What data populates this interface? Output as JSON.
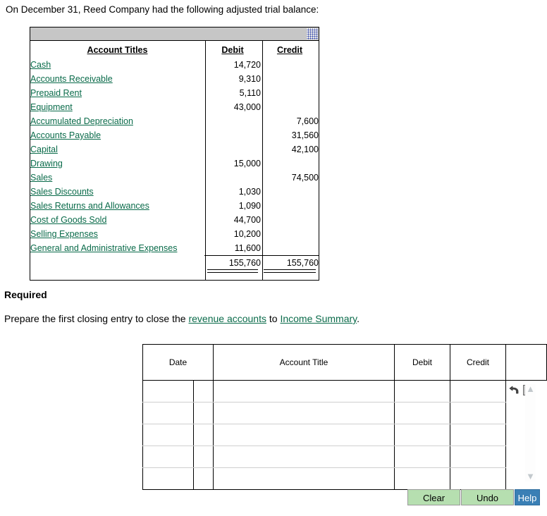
{
  "intro": "On December 31, Reed Company had the following adjusted trial balance:",
  "trial_balance": {
    "columns": [
      "Account Titles",
      "Debit",
      "Credit"
    ],
    "rows": [
      {
        "account": "Cash",
        "debit": "14,720",
        "credit": ""
      },
      {
        "account": "Accounts Receivable",
        "debit": "9,310",
        "credit": ""
      },
      {
        "account": "Prepaid Rent",
        "debit": "5,110",
        "credit": ""
      },
      {
        "account": "Equipment",
        "debit": "43,000",
        "credit": ""
      },
      {
        "account": "Accumulated Depreciation",
        "debit": "",
        "credit": "7,600"
      },
      {
        "account": "Accounts Payable",
        "debit": "",
        "credit": "31,560"
      },
      {
        "account": "Capital",
        "debit": "",
        "credit": "42,100"
      },
      {
        "account": "Drawing",
        "debit": "15,000",
        "credit": ""
      },
      {
        "account": "Sales",
        "debit": "",
        "credit": "74,500"
      },
      {
        "account": "Sales Discounts",
        "debit": "1,030",
        "credit": ""
      },
      {
        "account": "Sales Returns and Allowances",
        "debit": "1,090",
        "credit": ""
      },
      {
        "account": "Cost of Goods Sold",
        "debit": "44,700",
        "credit": ""
      },
      {
        "account": "Selling Expenses",
        "debit": "10,200",
        "credit": ""
      },
      {
        "account": "General and Administrative Expenses",
        "debit": "11,600",
        "credit": ""
      }
    ],
    "totals": {
      "debit": "155,760",
      "credit": "155,760"
    }
  },
  "required": {
    "heading": "Required",
    "text_before": "Prepare the first closing entry to close the ",
    "link1": "revenue accounts",
    "text_middle": " to ",
    "link2": "Income Summary",
    "text_after": "."
  },
  "journal": {
    "columns": [
      "Date",
      "Account Title",
      "Debit",
      "Credit"
    ],
    "rows": [
      {
        "date": "",
        "date2": "",
        "title": "",
        "debit": "",
        "credit": ""
      },
      {
        "date": "",
        "date2": "",
        "title": "",
        "debit": "",
        "credit": ""
      },
      {
        "date": "",
        "date2": "",
        "title": "",
        "debit": "",
        "credit": ""
      },
      {
        "date": "",
        "date2": "",
        "title": "",
        "debit": "",
        "credit": ""
      },
      {
        "date": "",
        "date2": "",
        "title": "",
        "debit": "",
        "credit": ""
      }
    ],
    "row_actions": {
      "delete_label": "×"
    }
  },
  "buttons": {
    "clear": "Clear",
    "undo": "Undo",
    "help": "Help"
  },
  "colors": {
    "link_green": "#0a6b4a",
    "button_green": "#b6dfb0",
    "help_blue": "#3a7fb5",
    "titlebar_gray": "#c6c6c6"
  }
}
